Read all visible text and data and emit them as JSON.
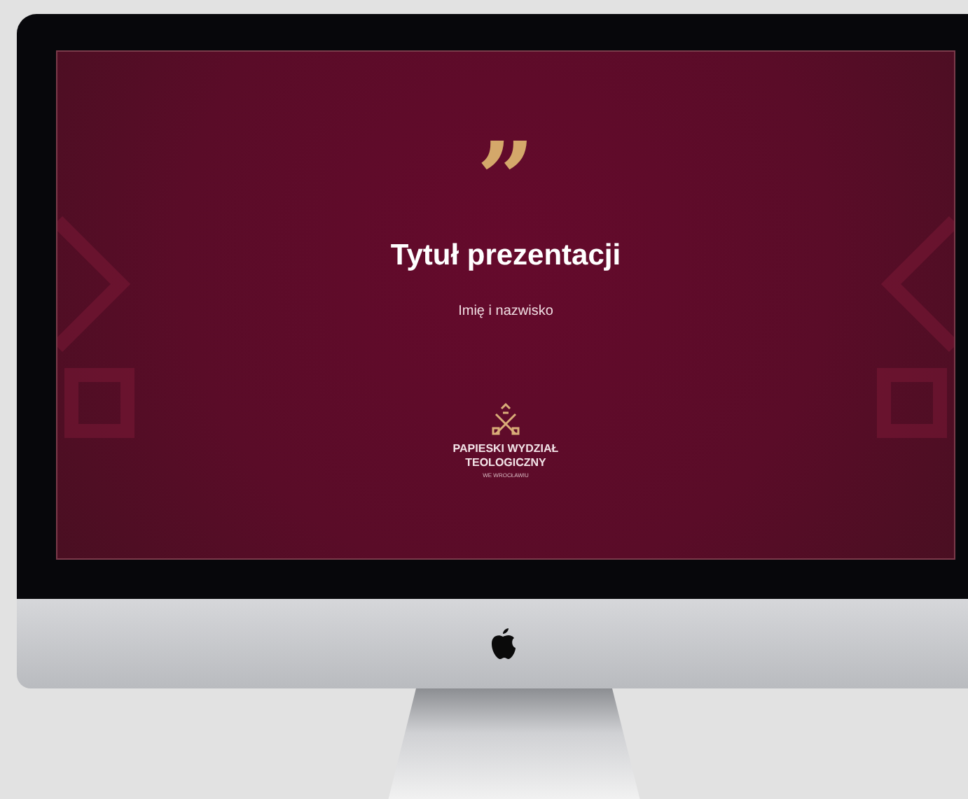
{
  "slide": {
    "quote_mark": "”",
    "title": "Tytuł prezentacji",
    "subtitle": "Imię i nazwisko",
    "logo": {
      "line_1": "PAPIESKI WYDZIAŁ",
      "line_2": "TEOLOGICZNY",
      "line_3": "WE WROCŁAWIU"
    }
  }
}
